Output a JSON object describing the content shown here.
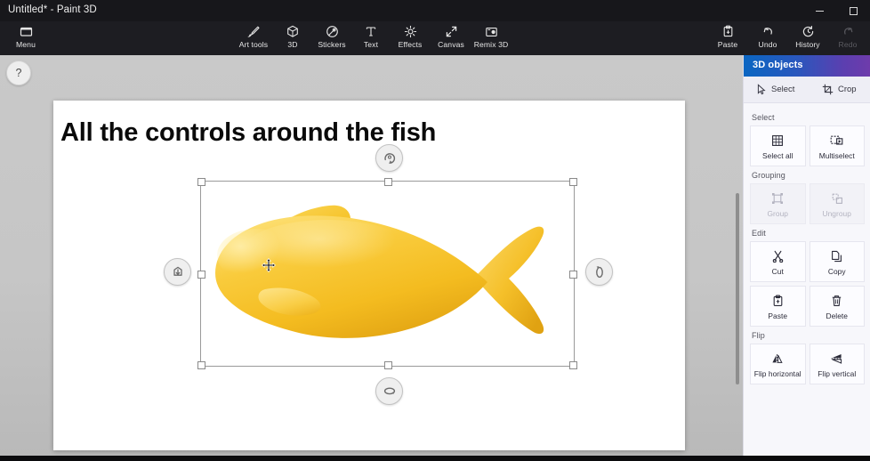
{
  "window": {
    "title": "Untitled* - Paint 3D",
    "controls": [
      {
        "name": "minimize",
        "glyph": "minimize-icon"
      },
      {
        "name": "maximize",
        "glyph": "maximize-icon"
      }
    ]
  },
  "ribbon": {
    "left_items": [
      {
        "id": "menu",
        "label": "Menu",
        "icon": "menu-rectangle-icon",
        "disabled": false
      }
    ],
    "center_items": [
      {
        "id": "art-tools",
        "label": "Art tools",
        "icon": "brush-icon",
        "disabled": false
      },
      {
        "id": "three-d",
        "label": "3D",
        "icon": "cube-icon",
        "disabled": false
      },
      {
        "id": "stickers",
        "label": "Stickers",
        "icon": "sticker-icon",
        "disabled": false
      },
      {
        "id": "text",
        "label": "Text",
        "icon": "text-t-icon",
        "disabled": false
      },
      {
        "id": "effects",
        "label": "Effects",
        "icon": "sun-icon",
        "disabled": false
      },
      {
        "id": "canvas",
        "label": "Canvas",
        "icon": "expand-arrows-icon",
        "disabled": false
      },
      {
        "id": "remix-3d",
        "label": "Remix 3D",
        "icon": "remix-icon",
        "disabled": false
      }
    ],
    "right_items": [
      {
        "id": "paste",
        "label": "Paste",
        "icon": "clipboard-icon",
        "disabled": false
      },
      {
        "id": "undo",
        "label": "Undo",
        "icon": "undo-arrow-icon",
        "disabled": false
      },
      {
        "id": "history",
        "label": "History",
        "icon": "history-clock-icon",
        "disabled": false
      },
      {
        "id": "redo",
        "label": "Redo",
        "icon": "redo-arrow-icon",
        "disabled": true
      }
    ]
  },
  "workspace": {
    "help_button": {
      "label": "?",
      "icon": "question-mark-icon"
    },
    "canvas": {
      "title_text": "All the controls around the fish",
      "object": {
        "name": "fish-3d-model",
        "color_primary": "#F7C22B",
        "color_shadow": "#E8A81C",
        "color_highlight": "#FBD95E"
      },
      "selection": {
        "move_cursor": "move-four-arrow-cursor",
        "handles": [
          "top-left",
          "top-center",
          "top-right",
          "middle-left",
          "middle-right",
          "bottom-left",
          "bottom-center",
          "bottom-right"
        ],
        "rotation_controls": [
          {
            "name": "rotate-top",
            "icon": "rotate-z-axis-icon",
            "position": "top"
          },
          {
            "name": "rotate-bottom",
            "icon": "rotate-horizontal-icon",
            "position": "bottom"
          },
          {
            "name": "depth-left",
            "icon": "move-depth-icon",
            "position": "left"
          },
          {
            "name": "rotate-right",
            "icon": "rotate-vertical-icon",
            "position": "right"
          }
        ]
      }
    },
    "scrollbar": {
      "name": "vertical-scrollbar"
    }
  },
  "panel": {
    "header_title": "3D objects",
    "header_gradient_start": "#0A66C2",
    "header_gradient_end": "#6F3BAB",
    "tabs": [
      {
        "id": "select",
        "label": "Select",
        "icon": "cursor-arrow-icon"
      },
      {
        "id": "crop",
        "label": "Crop",
        "icon": "crop-icon"
      }
    ],
    "sections": [
      {
        "label": "Select",
        "buttons": [
          {
            "id": "select-all",
            "label": "Select all",
            "icon": "select-all-grid-icon",
            "disabled": false
          },
          {
            "id": "multiselect",
            "label": "Multiselect",
            "icon": "multiselect-icon",
            "disabled": false
          }
        ]
      },
      {
        "label": "Grouping",
        "buttons": [
          {
            "id": "group",
            "label": "Group",
            "icon": "group-icon",
            "disabled": true
          },
          {
            "id": "ungroup",
            "label": "Ungroup",
            "icon": "ungroup-icon",
            "disabled": true
          }
        ]
      },
      {
        "label": "Edit",
        "buttons": [
          {
            "id": "cut",
            "label": "Cut",
            "icon": "scissors-icon",
            "disabled": false
          },
          {
            "id": "copy",
            "label": "Copy",
            "icon": "copy-pages-icon",
            "disabled": false
          },
          {
            "id": "paste",
            "label": "Paste",
            "icon": "clipboard-icon",
            "disabled": false
          },
          {
            "id": "delete",
            "label": "Delete",
            "icon": "trash-icon",
            "disabled": false
          }
        ]
      },
      {
        "label": "Flip",
        "buttons": [
          {
            "id": "flip-horizontal",
            "label": "Flip horizontal",
            "icon": "flip-horizontal-icon",
            "disabled": false
          },
          {
            "id": "flip-vertical",
            "label": "Flip vertical",
            "icon": "flip-vertical-icon",
            "disabled": false
          }
        ]
      }
    ]
  }
}
